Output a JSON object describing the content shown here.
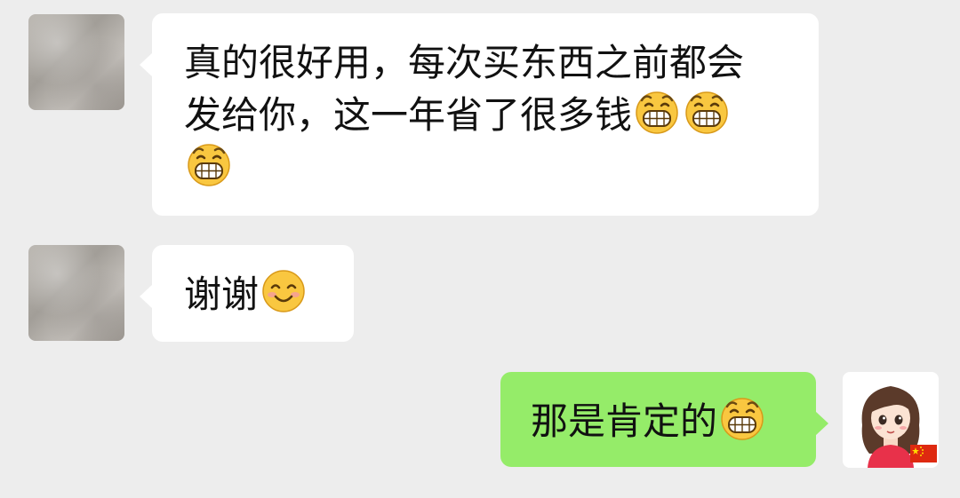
{
  "messages": [
    {
      "side": "in",
      "lines": [
        {
          "text": "真的很好用，每次买东西之前都会",
          "emojis": []
        },
        {
          "text": "发给你，这一年省了很多钱",
          "emojis": [
            "grin-icon",
            "grin-icon"
          ]
        },
        {
          "text": "",
          "emojis": [
            "grin-icon"
          ]
        }
      ]
    },
    {
      "side": "in",
      "lines": [
        {
          "text": "谢谢",
          "emojis": [
            "smile-icon"
          ]
        }
      ]
    },
    {
      "side": "out",
      "lines": [
        {
          "text": "那是肯定的",
          "emojis": [
            "grin-icon"
          ]
        }
      ]
    }
  ],
  "colors": {
    "background": "#ededed",
    "incoming_bubble": "#ffffff",
    "outgoing_bubble": "#95ec69"
  },
  "user_avatar": {
    "badge_icon": "china-flag-icon"
  }
}
